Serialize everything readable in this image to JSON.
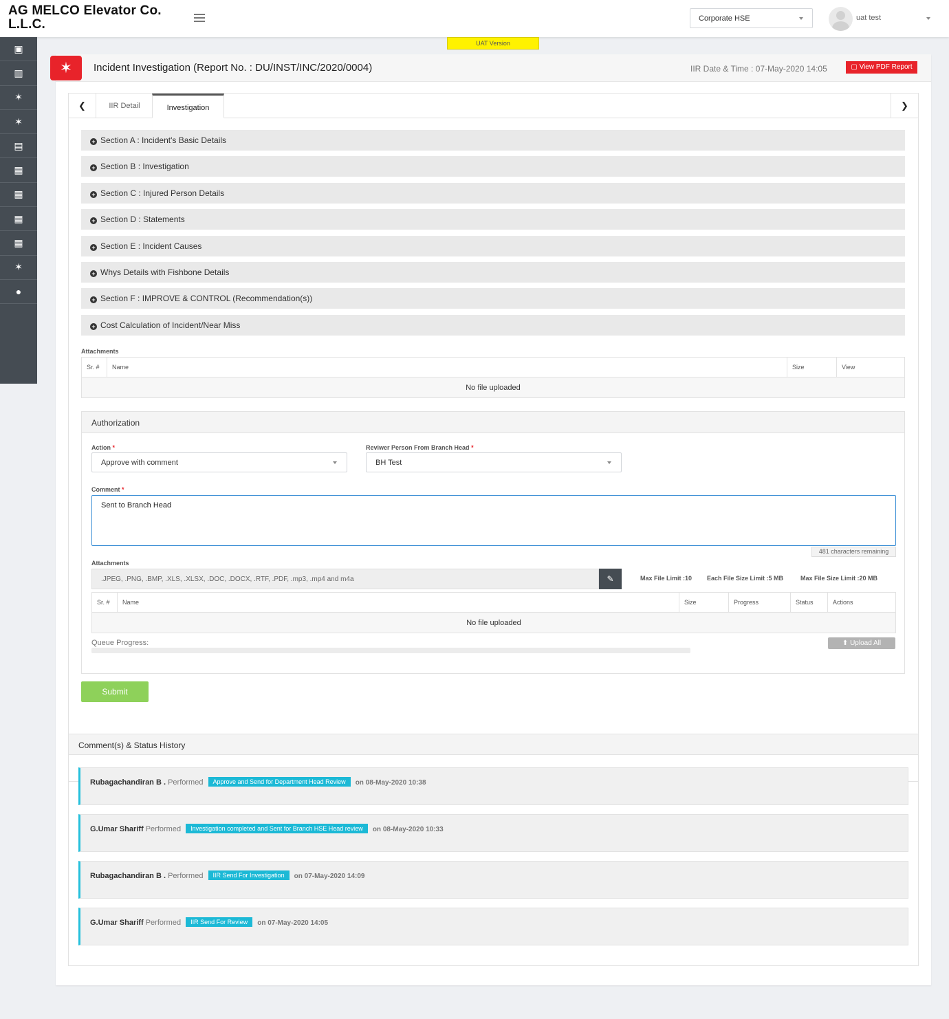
{
  "header": {
    "company_line1": "AG MELCO Elevator Co.",
    "company_line2": "L.L.C.",
    "branch_select": "Corporate HSE",
    "user_name": "uat test",
    "uat_label": "UAT Version"
  },
  "sidebar": {
    "items": [
      "dashboard-icon",
      "library-icon",
      "incident-icon",
      "incident-icon",
      "id-card-icon",
      "report-icon",
      "report-icon",
      "report-icon",
      "report-icon",
      "incident-icon",
      "chat-icon"
    ]
  },
  "page": {
    "title": "Incident Investigation (Report No. : DU/INST/INC/2020/0004)",
    "iir_date": "IIR Date & Time : 07-May-2020 14:05",
    "pdf_button": "View PDF Report"
  },
  "tabs": [
    {
      "label": "IIR Detail"
    },
    {
      "label": "Investigation"
    }
  ],
  "sections": [
    "Section A : Incident's Basic Details",
    "Section B : Investigation",
    "Section C : Injured Person Details",
    "Section D : Statements",
    "Section E : Incident Causes",
    "Whys Details with Fishbone Details",
    "Section F : IMPROVE & CONTROL (Recommendation(s))",
    "Cost Calculation of Incident/Near Miss"
  ],
  "attachments": {
    "label": "Attachments",
    "columns": [
      "Sr. #",
      "Name",
      "Size",
      "View"
    ],
    "empty": "No file uploaded"
  },
  "authorization": {
    "title": "Authorization",
    "action_label": "Action",
    "action_value": "Approve with comment",
    "reviewer_label": "Reviwer Person From Branch Head",
    "reviewer_value": "BH Test",
    "comment_label": "Comment",
    "comment_value": "Sent to Branch Head",
    "chars_remaining": "481 characters remaining",
    "attach_label": "Attachments",
    "file_types": ".JPEG, .PNG, .BMP, .XLS, .XLSX, .DOC, .DOCX, .RTF, .PDF, .mp3, .mp4 and m4a",
    "max_file_limit": "Max File Limit :10",
    "each_file_size": "Each File Size Limit :5 MB",
    "max_file_size": "Max File Size Limit :20 MB",
    "columns": [
      "Sr. #",
      "Name",
      "Size",
      "Progress",
      "Status",
      "Actions"
    ],
    "empty": "No file uploaded",
    "queue_label": "Queue Progress:",
    "queue_progress": 0,
    "upload_all": "Upload All",
    "submit": "Submit"
  },
  "history": {
    "title": "Comment(s) & Status History",
    "entries": [
      {
        "name": "Rubagachandiran B .",
        "performed": "Performed",
        "action": "Approve and Send for Department Head Review",
        "when": "on 08-May-2020 10:38"
      },
      {
        "name": "G.Umar Shariff",
        "performed": "Performed",
        "action": "Investigation completed and Sent for Branch HSE Head review",
        "when": "on 08-May-2020 10:33"
      },
      {
        "name": "Rubagachandiran B .",
        "performed": "Performed",
        "action": "IIR Send For Investigation",
        "when": "on 07-May-2020 14:09"
      },
      {
        "name": "G.Umar Shariff",
        "performed": "Performed",
        "action": "IIR Send For Review",
        "when": "on 07-May-2020 14:05"
      }
    ]
  }
}
